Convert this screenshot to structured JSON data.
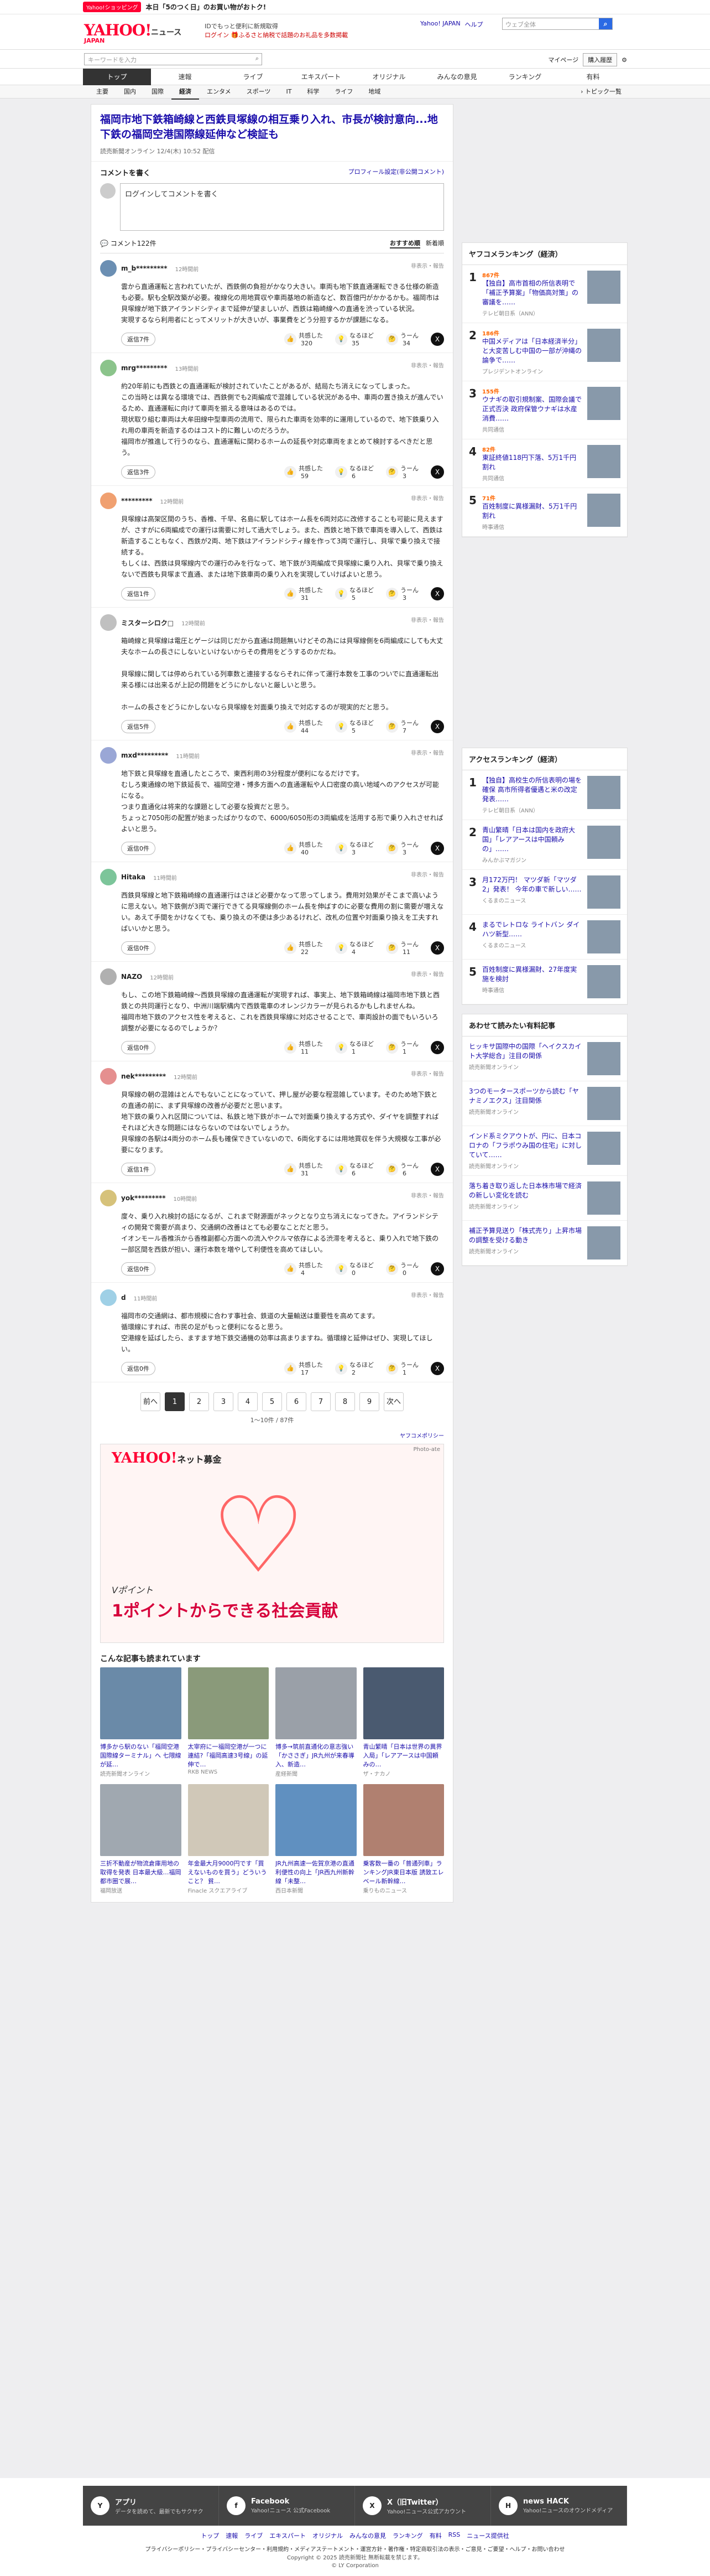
{
  "promo": {
    "badge": "Yahoo!ショッピング",
    "text": "本日「5のつく日」のお買い物がおトク!"
  },
  "header": {
    "logo": "YAHOO!",
    "logo_sub": "JAPAN",
    "service": "ニュース",
    "note1": "IDでもっと便利に新規取得",
    "note2": "ログイン 🎁ふるさと納税で話題のお礼品を多数掲載",
    "links": [
      "Yahoo! JAPAN",
      "ヘルプ"
    ],
    "search_placeholder": "ウェブ全体"
  },
  "searchbar": {
    "placeholder": "キーワードを入力",
    "mypage": "マイページ",
    "view": "購入履歴"
  },
  "nav": [
    "トップ",
    "速報",
    "ライブ",
    "エキスパート",
    "オリジナル",
    "みんなの意見",
    "ランキング",
    "有料"
  ],
  "subnav": {
    "items": [
      "主要",
      "国内",
      "国際",
      "経済",
      "エンタメ",
      "スポーツ",
      "IT",
      "科学",
      "ライフ",
      "地域"
    ],
    "active": 3,
    "more": "トピック一覧"
  },
  "article": {
    "title": "福岡市地下鉄箱崎線と西鉄貝塚線の相互乗り入れ、市長が検討意向...地下鉄の福岡空港国際線延伸など検証も",
    "meta": "読売新聞オンライン 12/4(木) 10:52 配信"
  },
  "comment_form": {
    "heading": "コメントを書く",
    "profile_link": "プロフィール設定(非公開コメント)",
    "placeholder": "ログインしてコメントを書く"
  },
  "comments_header": {
    "count": "コメント122件",
    "sort_a": "おすすめ順",
    "sort_b": "新着順"
  },
  "labels": {
    "reply": "返信",
    "agree": "共感した",
    "think": "なるほど",
    "disagree": "うーん",
    "report": "非表示・報告"
  },
  "comments": [
    {
      "user": "m_b*********",
      "time": "12時間前",
      "body": "雲から直通運転と言われていたが、西鉄側の負担がかなり大きい。車両も地下鉄直通運転できる仕様の新造も必要。駅も全駅改築が必要。複線化の用地買収や車両基地の新造など、数百億円がかかるかも。福岡市は貝塚線が地下鉄アイランドシティまで延伸が望ましいが、西鉄は箱崎線への直通を渋っている状況。\n実現するなら利用者にとってメリットが大きいが、事業費をどう分担するかが課題になる。",
      "replies": "返信7件",
      "agree": "320",
      "think": "35",
      "dis": "34"
    },
    {
      "user": "mrg*********",
      "time": "13時間前",
      "body": "約20年前にも西鉄との直通運転が検討されていたことがあるが、結局たち消えになってしまった。\nこの当時とは異なる環境では、西鉄側でも2両編成で混雑している状況がある中、車両の置き換えが進んでいるため、直通運転に向けて車両を揃える意味はあるのでは。\n現状取り組む車両は大牟田線中型車両の流用で、限られた車両を効率的に運用しているので、地下鉄乗り入れ用の車両を新造するのはコスト的に難しいのだろうか。\n福岡市が推進して行うのなら、直通運転に関わるホームの延長や対応車両をまとめて検討するべきだと思う。",
      "replies": "返信3件",
      "agree": "59",
      "think": "6",
      "dis": "3"
    },
    {
      "user": "*********",
      "time": "12時間前",
      "body": "貝塚線は高架区間のうち、香椎、千早、名島に駅してはホーム長を6両対応に改修することも可能に見えますが、さすがに6両編成での運行は需要に対して過大でしょう。また、西鉄と地下鉄で車両を導入して、西鉄は新造することもなく、西鉄が2両、地下鉄はアイランドシティ線を作って3両で運行し、貝塚で乗り換えで接続する。\nもしくは、西鉄は貝塚線内での運行のみを行なって、地下鉄が3両編成で貝塚線に乗り入れ、貝塚で乗り換えないで西鉄も貝塚まで直通、または地下鉄車両の乗り入れを実現していけばよいと思う。",
      "replies": "返信1件",
      "agree": "31",
      "think": "5",
      "dis": "3"
    },
    {
      "user": "ミスターシロク□",
      "time": "12時間前",
      "body": "箱崎線と貝塚線は電圧とゲージは同じだから直通は問題無いけどその為には貝塚線側を6両編成にしても大丈夫なホームの長さにしないといけないからその費用をどうするのかだね。\n\n貝塚線に関しては停められている列車数と連接するならそれに伴って運行本数を工事のついでに直通運転出来る様には出来るが上記の問題をどうにかしないと厳しいと思う。\n\nホームの長さをどうにかしないなら貝塚線を対面乗り換えで対応するのが現実的だと思う。",
      "replies": "返信5件",
      "agree": "44",
      "think": "5",
      "dis": "7"
    },
    {
      "user": "mxd*********",
      "time": "11時間前",
      "body": "地下鉄と貝塚線を直通したところで、東西利用の3分程度が便利になるだけです。\nむしろ東通線の地下鉄延長で、福岡空港・博多方面への直通運転や人口密度の高い地域へのアクセスが可能になる。\nつまり直通化は将来的な課題として必要な投資だと思う。\nちょっと7050形の配置が始まったばかりなので、6000/6050形の3両編成を活用する形で乗り入れさせればよいと思う。",
      "replies": "返信0件",
      "agree": "40",
      "think": "3",
      "dis": "3"
    },
    {
      "user": "Hitaka",
      "time": "11時間前",
      "body": "西鉄貝塚線と地下鉄箱崎線の直通運行はさほど必要かなって思ってしまう。費用対効果がそこまで高いように思えない。地下鉄側が3両で運行できてる貝塚線側のホーム長を伸ばすのに必要な費用の割に需要が増えない。あえて手間をかけなくても、乗り換えの不便は多少あるけれど、改札の位置や対面乗り換えを工夫すればいいかと思う。",
      "replies": "返信0件",
      "agree": "22",
      "think": "4",
      "dis": "11"
    },
    {
      "user": "NAZO",
      "time": "12時間前",
      "body": "もし、この地下鉄箱崎線～西鉄貝塚線の直通運転が実現すれば、事実上、地下鉄箱崎線は福岡市地下鉄と西鉄との共同運行となり、中洲川端駅構内で西鉄電車のオレンジカラーが見られるかもしれませんね。\n福岡市地下鉄のアクセス性を考えると、これを西鉄貝塚線に対応させることで、車両設計の面でもいろいろ調整が必要になるのでしょうか？",
      "replies": "返信0件",
      "agree": "11",
      "think": "1",
      "dis": "1"
    },
    {
      "user": "nek*********",
      "time": "12時間前",
      "body": "貝塚線の朝の混雑はとんでもないことになっていて、押し屋が必要な程混雑しています。そのため地下鉄との直通の前に、まず貝塚線の改善が必要だと思います。\n地下鉄の乗り入れ区間については、私鉄と地下鉄がホームで対面乗り換えする方式や、ダイヤを調整すればそれほど大きな問題にはならないのではないでしょうか。\n貝塚線の各駅は4両分のホーム長も確保できていないので、6両化するには用地買収を伴う大規模な工事が必要になります。",
      "replies": "返信1件",
      "agree": "31",
      "think": "6",
      "dis": "6"
    },
    {
      "user": "yok*********",
      "time": "10時間前",
      "body": "度々、乗り入れ検討の話になるが、これまで財源面がネックとなり立ち消えになってきた。アイランドシティの開発で需要が高まり、交通網の改善はとても必要なことだと思う。\nイオンモール香椎浜から香椎副都心方面への流入やクルマ依存による渋滞を考えると、乗り入れで地下鉄の一部区間を西鉄が担い、運行本数を増やして利便性を高めてほしい。",
      "replies": "返信0件",
      "agree": "4",
      "think": "0",
      "dis": "0"
    },
    {
      "user": "d",
      "time": "11時間前",
      "body": "福岡市の交通網は、都市規模に合わす事社会、鉄道の大量輸送は重要性を高めてます。\n循環線にすれば、市民の足がもっと便利になると思う。\n空港線を延ばしたら、ますます地下鉄交通機の効率は高まりますね。循環線と延伸はぜひ、実現してほしい。",
      "replies": "返信0件",
      "agree": "17",
      "think": "2",
      "dis": "1"
    }
  ],
  "pager": {
    "prev": "前へ",
    "pages": [
      "1",
      "2",
      "3",
      "4",
      "5",
      "6",
      "7",
      "8",
      "9"
    ],
    "next": "次へ",
    "info": "1〜10件 / 87件"
  },
  "policy": "ヤフコメポリシー",
  "ad": {
    "logo": "YAHOO!",
    "logo_sub": "ネット募金",
    "tag": "Photo-ate",
    "line1": "Vポイント",
    "line2": "1ポイントからできる社会貢献"
  },
  "also_read": {
    "heading": "こんな記事も読まれています",
    "items": [
      {
        "t": "博多から駅のない「福岡空港国際線ターミナル」へ 七隈線が延…",
        "s": "読売新聞オンライン"
      },
      {
        "t": "太宰府に一福岡空港が一つに連結?「福岡高速3号線」の延伸で…",
        "s": "RKB NEWS"
      },
      {
        "t": "博多→筑前直通化の意志強い「かささぎ」JR九州が来春導入、新造…",
        "s": "産経新聞"
      },
      {
        "t": "青山繁晴「日本は世界の異界入局」「レアアースは中国頼みの…",
        "s": "ザ・ナカノ"
      },
      {
        "t": "三折不動産が物流倉庫用地の取得を発表 日本最大級…福岡都市圏で展…",
        "s": "福岡放送"
      },
      {
        "t": "年金最大月9000円です「買えないものを買う」どういうこと？ 貧…",
        "s": "Finacle スクエアライブ"
      },
      {
        "t": "JR九州高速一佐賀京港の直通利便性の向上「JR西九州新幹線「未整…",
        "s": "西日本新聞"
      },
      {
        "t": "乗客数一番の「普通列車」ランキングJR東日本版 誘致エレベール新幹線…",
        "s": "乗りものニュース"
      }
    ]
  },
  "sidebar": {
    "ranking_title": "ヤフコメランキング（経済）",
    "ranking": [
      {
        "n": "1",
        "cnt": "867件",
        "t": "【独自】高市首相の所信表明で「補正予算案」「物価高対策」の審議を……",
        "s": "テレビ朝日系（ANN）"
      },
      {
        "n": "2",
        "cnt": "186件",
        "t": "中国メディアは「日本経済半分」と大変苦しむ中国の一部が沖縄の論争で……",
        "s": "プレジデントオンライン"
      },
      {
        "n": "3",
        "cnt": "155件",
        "t": "ウナギの取引規制案、国際会議で正式否決 政府保管ウナギは水産消費……",
        "s": "共同通信"
      },
      {
        "n": "4",
        "cnt": "82件",
        "t": "東証終値118円下落、5万1千円割れ",
        "s": "共同通信"
      },
      {
        "n": "5",
        "cnt": "71件",
        "t": "百姓制度に異様漏財、5万1千円割れ",
        "s": "時事通信"
      }
    ],
    "access_title": "アクセスランキング（経済）",
    "access": [
      {
        "n": "1",
        "t": "【独自】高校生の所信表明の場を確保 高市所得者優遇と米の改定発表……",
        "s": "テレビ朝日系（ANN）"
      },
      {
        "n": "2",
        "t": "青山繁晴「日本は国内を政府大国」「レアアースは中国頼みの」……",
        "s": "みんかぶマガジン"
      },
      {
        "n": "3",
        "t": "月172万円！ マツダ新「マツダ2」発表！ 今年の車で新しい……",
        "s": "くるまのニュース"
      },
      {
        "n": "4",
        "t": "まるでレトロな ライトバン ダイハツ新型……",
        "s": "くるまのニュース"
      },
      {
        "n": "5",
        "t": "百姓制度に異様漏財、27年度実施を検討",
        "s": "時事通信"
      }
    ],
    "recommend_title": "あわせて読みたい有料記事",
    "recommend": [
      {
        "t": "ヒッキサ国際中の国際「ヘイクスカイト大学総合」注目の関係",
        "s": "読売新聞オンライン"
      },
      {
        "t": "3つのモータースポーツから読む「ヤナミノエクス」注目関係",
        "s": "読売新聞オンライン"
      },
      {
        "t": "インド系ミクアウトが、円に、日本コロナの「フラポウみ国の住宅」に対していて……",
        "s": "読売新聞オンライン"
      },
      {
        "t": "落ち着き取り返した日本株市場で経済の新しい変化を読む",
        "s": "読売新聞オンライン"
      },
      {
        "t": "補正予算見送り「株式売り」上昇市場の調整を受ける動き",
        "s": "読売新聞オンライン"
      }
    ]
  },
  "footer": {
    "items": [
      {
        "ic": "Y",
        "t": "アプリ",
        "s": "データを読めて、最新でもサクサク"
      },
      {
        "ic": "f",
        "t": "Facebook",
        "s": "Yahoo!ニュース 公式Facebook"
      },
      {
        "ic": "X",
        "t": "X（旧Twitter）",
        "s": "Yahoo!ニュース公式アカウント"
      },
      {
        "ic": "H",
        "t": "news HACK",
        "s": "Yahoo!ニュースのオウンドメディア"
      }
    ],
    "nav": [
      "トップ",
      "速報",
      "ライブ",
      "エキスパート",
      "オリジナル",
      "みんなの意見",
      "ランキング",
      "有料",
      "RSS",
      "ニュース提供社"
    ],
    "links": "プライバシーポリシー・プライバシーセンター・利用規約・メディアステートメント・運営方針・著作権・特定商取引法の表示・ご意見・ご要望・ヘルプ・お問い合わせ",
    "copy1": "Copyright © 2025 読売新聞社 無断転載を禁じます。",
    "copy2": "© LY Corporation"
  }
}
